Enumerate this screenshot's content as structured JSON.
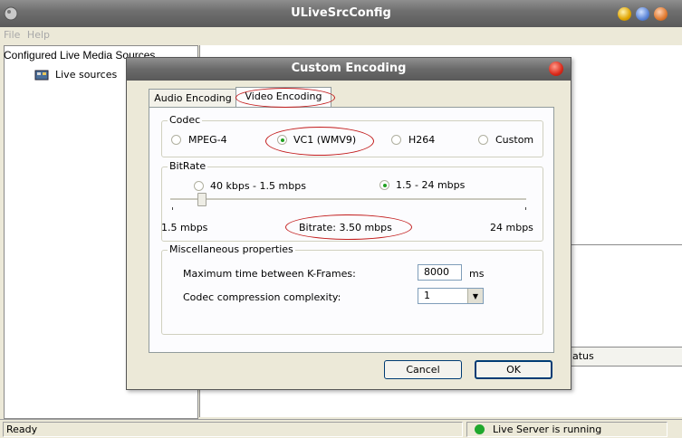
{
  "window": {
    "title": "ULiveSrcConfig"
  },
  "menu": {
    "file": "File",
    "help": "Help"
  },
  "left_panel": {
    "header": "Configured Live Media Sources",
    "tree_item": "Live sources"
  },
  "right_panel": {
    "column_partial": "atus"
  },
  "status": {
    "left": "Ready",
    "right": "Live Server is running"
  },
  "dialog": {
    "title": "Custom Encoding",
    "tabs": [
      "Audio Encoding",
      "Video Encoding"
    ],
    "active_tab": "Video Encoding",
    "codec": {
      "label": "Codec",
      "options": [
        "MPEG-4",
        "VC1 (WMV9)",
        "H264",
        "Custom"
      ],
      "selected": "VC1 (WMV9)"
    },
    "bitrate": {
      "label": "BitRate",
      "options": [
        "40 kbps - 1.5 mbps",
        "1.5 - 24 mbps"
      ],
      "selected": "1.5 - 24 mbps",
      "min_label": "1.5 mbps",
      "max_label": "24 mbps",
      "current_label": "Bitrate: 3.50 mbps",
      "slider_fraction": 0.09
    },
    "misc": {
      "label": "Miscellaneous properties",
      "kframe_label": "Maximum time between K-Frames:",
      "kframe_value": "8000",
      "kframe_unit": "ms",
      "complexity_label": "Codec compression complexity:",
      "complexity_value": "1"
    },
    "buttons": {
      "cancel": "Cancel",
      "ok": "OK"
    }
  },
  "colors": {
    "annotation": "#c21b1b",
    "status_ok": "#1fa82d"
  }
}
